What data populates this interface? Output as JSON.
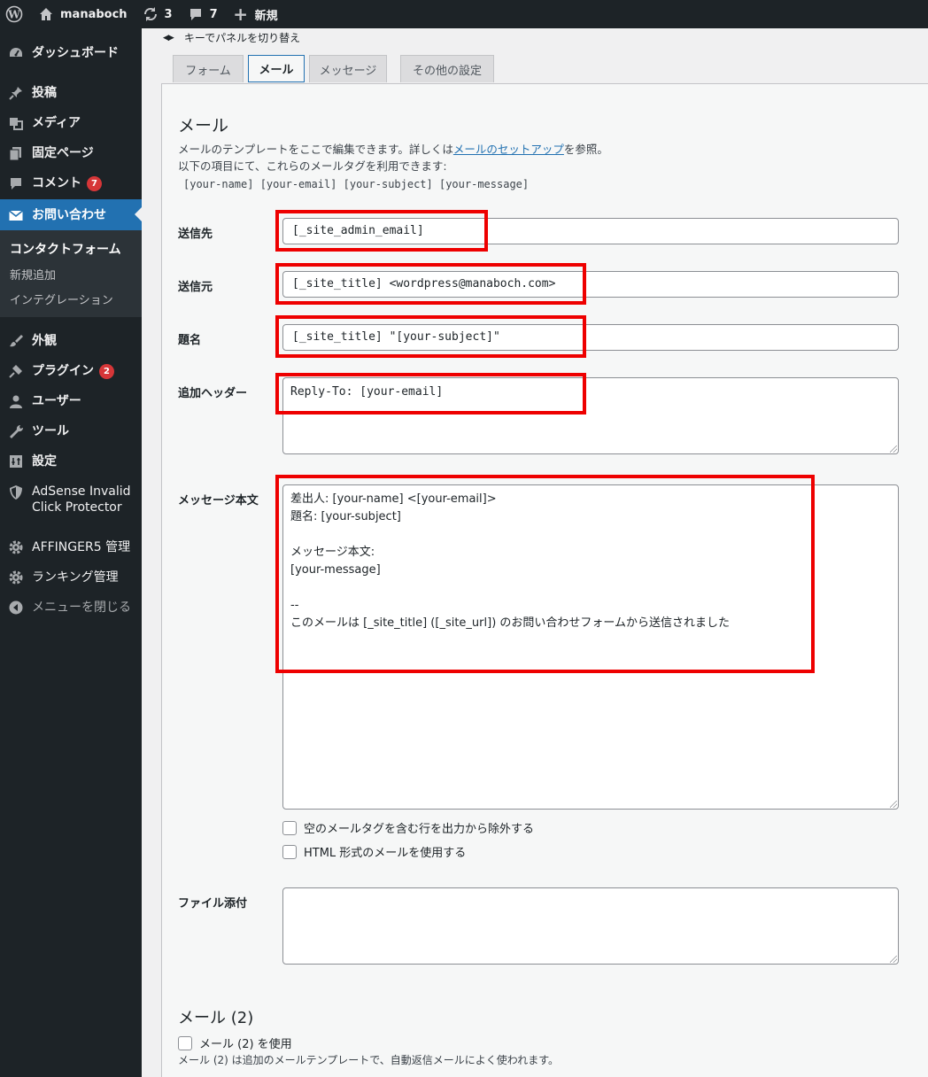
{
  "adminbar": {
    "site_name": "manaboch",
    "updates_count": "3",
    "comments_count": "7",
    "new_label": "新規"
  },
  "sidebar": {
    "items": [
      {
        "label": "ダッシュボード",
        "icon": "dashboard-icon"
      },
      {
        "label": "投稿",
        "icon": "pin-icon"
      },
      {
        "label": "メディア",
        "icon": "media-icon"
      },
      {
        "label": "固定ページ",
        "icon": "page-icon"
      },
      {
        "label": "コメント",
        "icon": "comment-icon",
        "badge": "7"
      },
      {
        "label": "お問い合わせ",
        "icon": "mail-icon"
      },
      {
        "label": "外観",
        "icon": "brush-icon"
      },
      {
        "label": "プラグイン",
        "icon": "plugin-icon",
        "badge": "2"
      },
      {
        "label": "ユーザー",
        "icon": "user-icon"
      },
      {
        "label": "ツール",
        "icon": "wrench-icon"
      },
      {
        "label": "設定",
        "icon": "settings-icon"
      },
      {
        "label": "AdSense Invalid",
        "label2": "Click Protector",
        "icon": "shield-icon"
      },
      {
        "label": "AFFINGER5 管理",
        "icon": "gear-icon"
      },
      {
        "label": "ランキング管理",
        "icon": "gear-icon"
      },
      {
        "label": "メニューを閉じる",
        "icon": "collapse-icon"
      }
    ],
    "submenu": [
      "コンタクトフォーム",
      "新規追加",
      "インテグレーション"
    ]
  },
  "main": {
    "hint": "キーでパネルを切り替え",
    "tabs": [
      "フォーム",
      "メール",
      "メッセージ",
      "その他の設定"
    ],
    "mail": {
      "title": "メール",
      "desc_before": "メールのテンプレートをここで編集できます。詳しくは",
      "desc_link": "メールのセットアップ",
      "desc_after": "を参照。",
      "desc_line2": "以下の項目にて、これらのメールタグを利用できます:",
      "tags": "[your-name] [your-email] [your-subject] [your-message]",
      "fields": {
        "to_label": "送信先",
        "to_value": "[_site_admin_email]",
        "from_label": "送信元",
        "from_value": "[_site_title] <wordpress@manaboch.com>",
        "subject_label": "題名",
        "subject_value": "[_site_title] \"[your-subject]\"",
        "headers_label": "追加ヘッダー",
        "headers_value": "Reply-To: [your-email]",
        "body_label": "メッセージ本文",
        "body_value": "差出人: [your-name] <[your-email]>\n題名: [your-subject]\n\nメッセージ本文:\n[your-message]\n\n--\nこのメールは [_site_title] ([_site_url]) のお問い合わせフォームから送信されました",
        "exclude_blank_label": "空のメールタグを含む行を出力から除外する",
        "html_label": "HTML 形式のメールを使用する",
        "attachments_label": "ファイル添付",
        "attachments_value": ""
      }
    },
    "mail2": {
      "title": "メール (2)",
      "use_label": "メール (2) を使用",
      "desc": "メール (2) は追加のメールテンプレートで、自動返信メールによく使われます。"
    }
  }
}
